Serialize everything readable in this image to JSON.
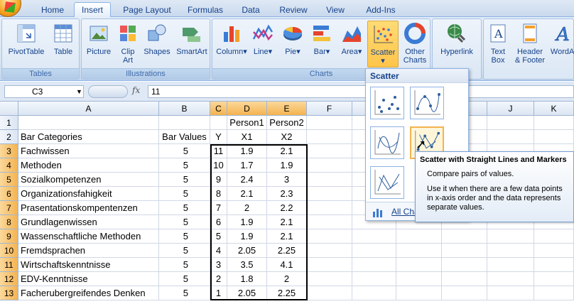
{
  "tabs": [
    "Home",
    "Insert",
    "Page Layout",
    "Formulas",
    "Data",
    "Review",
    "View",
    "Add-Ins"
  ],
  "active_tab": "Insert",
  "ribbon": {
    "tables": {
      "label": "Tables",
      "pivot": "PivotTable",
      "table": "Table"
    },
    "illustrations": {
      "label": "Illustrations",
      "picture": "Picture",
      "clipart": "Clip Art",
      "shapes": "Shapes",
      "smartart": "SmartArt"
    },
    "charts": {
      "label": "Charts",
      "column": "Column",
      "line": "Line",
      "pie": "Pie",
      "bar": "Bar",
      "area": "Area",
      "scatter": "Scatter",
      "other": "Other Charts"
    },
    "links": {
      "hyperlink": "Hyperlink"
    },
    "text": {
      "textbox": "Text Box",
      "header": "Header & Footer",
      "wordart": "WordArt"
    }
  },
  "formula_bar": {
    "name_box": "C3",
    "fx": "fx",
    "value": "11"
  },
  "columns": [
    "A",
    "B",
    "C",
    "D",
    "E",
    "F",
    "G",
    "H",
    "I",
    "J",
    "K"
  ],
  "rows": [
    "1",
    "2",
    "3",
    "4",
    "5",
    "6",
    "7",
    "8",
    "9",
    "10",
    "11",
    "12",
    "13"
  ],
  "sheet": {
    "row1": {
      "D": "Person1",
      "E": "Person2"
    },
    "row2": {
      "A": "Bar Categories",
      "B": "Bar Values",
      "C": "Y",
      "D": "X1",
      "E": "X2"
    },
    "data": [
      {
        "A": "Fachwissen",
        "B": "5",
        "C": "11",
        "D": "1.9",
        "E": "2.1"
      },
      {
        "A": "Methoden",
        "B": "5",
        "C": "10",
        "D": "1.7",
        "E": "1.9"
      },
      {
        "A": "Sozialkompetenzen",
        "B": "5",
        "C": "9",
        "D": "2.4",
        "E": "3"
      },
      {
        "A": "Organizationsfahigkeit",
        "B": "5",
        "C": "8",
        "D": "2.1",
        "E": "2.3"
      },
      {
        "A": "Prasentationskompentenzen",
        "B": "5",
        "C": "7",
        "D": "2",
        "E": "2.2"
      },
      {
        "A": "Grundlagenwissen",
        "B": "5",
        "C": "6",
        "D": "1.9",
        "E": "2.1"
      },
      {
        "A": "Wassenschaftliche Methoden",
        "B": "5",
        "C": "5",
        "D": "1.9",
        "E": "2.1"
      },
      {
        "A": "Fremdsprachen",
        "B": "5",
        "C": "4",
        "D": "2.05",
        "E": "2.25"
      },
      {
        "A": "Wirtschaftskenntnisse",
        "B": "5",
        "C": "3",
        "D": "3.5",
        "E": "4.1"
      },
      {
        "A": "EDV-Kenntnisse",
        "B": "5",
        "C": "2",
        "D": "1.8",
        "E": "2"
      },
      {
        "A": "Facherubergreifendes Denken",
        "B": "5",
        "C": "1",
        "D": "2.05",
        "E": "2.25"
      }
    ]
  },
  "scatter_menu": {
    "header": "Scatter",
    "all_charts": "All Cha"
  },
  "tooltip": {
    "title": "Scatter with Straight Lines and Markers",
    "line1": "Compare pairs of values.",
    "line2": "Use it when there are a few data points in x-axis order and the data represents separate values."
  }
}
